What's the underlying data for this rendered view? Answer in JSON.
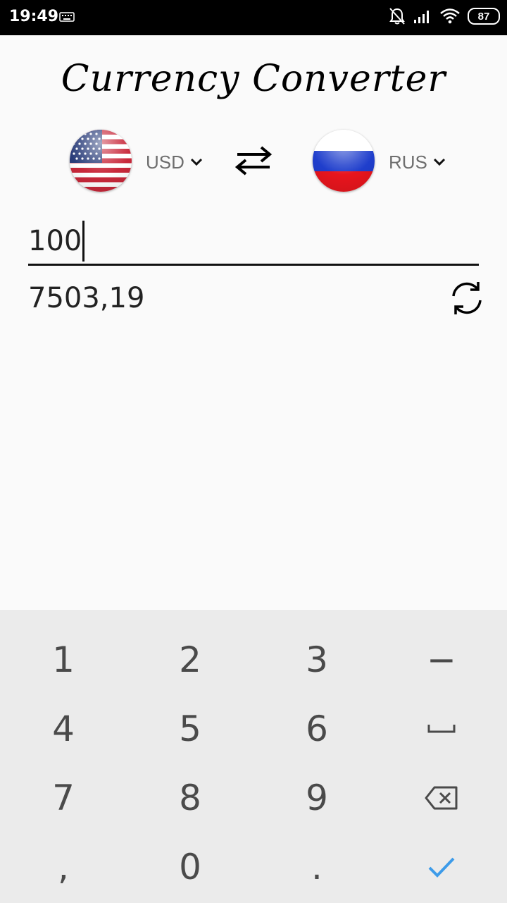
{
  "status_bar": {
    "time": "19:49",
    "battery": "87",
    "icons": [
      "keyboard-icon",
      "bell-off-icon",
      "signal-icon",
      "wifi-icon",
      "battery-icon"
    ]
  },
  "app": {
    "title": "Currency Converter"
  },
  "from_currency": {
    "code": "USD",
    "flag": "us-flag-icon"
  },
  "to_currency": {
    "code": "RUS",
    "flag": "russia-flag-icon"
  },
  "amount_input": {
    "value": "100"
  },
  "result": {
    "value": "7503,19"
  },
  "keypad": {
    "keys": [
      "1",
      "2",
      "3",
      "−",
      "4",
      "5",
      "6",
      "",
      "7",
      "8",
      "9",
      "",
      ",",
      "0",
      ".",
      ""
    ],
    "key_icons": {
      "space": "space-icon",
      "backspace": "backspace-icon",
      "done": "check-icon"
    },
    "accent": "#3d9be9"
  }
}
